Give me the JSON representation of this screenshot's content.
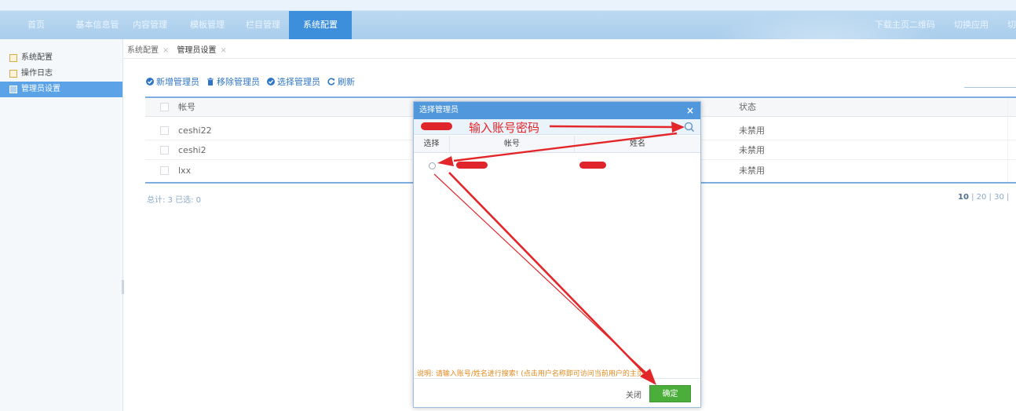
{
  "nav": {
    "items": [
      {
        "label": "首页"
      },
      {
        "label": "基本信息管理"
      },
      {
        "label": "内容管理"
      },
      {
        "label": "模板管理"
      },
      {
        "label": "栏目管理"
      },
      {
        "label": "系统配置",
        "active": true
      }
    ],
    "right": {
      "download": "下载主页二维码",
      "switch_app": "切换应用",
      "switch_more": "切"
    }
  },
  "sidebar": {
    "items": [
      {
        "label": "系统配置"
      },
      {
        "label": "操作日志"
      },
      {
        "label": "管理员设置",
        "active": true
      }
    ]
  },
  "tabs": [
    {
      "label": "系统配置",
      "close": "×"
    },
    {
      "label": "管理员设置",
      "close": "×",
      "active": true
    }
  ],
  "toolbar": {
    "add": "新增管理员",
    "remove": "移除管理员",
    "select": "选择管理员",
    "refresh": "刷新"
  },
  "table": {
    "columns": {
      "account": "帐号",
      "status": "状态"
    },
    "rows": [
      {
        "account": "ceshi22",
        "status": "未禁用"
      },
      {
        "account": "ceshi2",
        "status": "未禁用"
      },
      {
        "account": "lxx",
        "status": "未禁用"
      }
    ]
  },
  "footer": {
    "total": "总计: 3 已选: 0",
    "pager_current": "10",
    "pager_rest": " | 20 | 30 | "
  },
  "modal": {
    "title": "选择管理员",
    "close_symbol": "×",
    "columns": {
      "select": "选择",
      "account": "帐号",
      "name": "姓名"
    },
    "note": "说明: 请输入账号/姓名进行搜索! (点击用户名称即可访问当前用户的主页)",
    "close_button": "关闭",
    "confirm_button": "确定"
  },
  "annotation": {
    "text": "输入账号密码"
  },
  "colors": {
    "accent": "#5097db",
    "nav_active": "#3d8fdc",
    "sidebar_active": "#5ba3e6",
    "confirm": "#4cae3a",
    "annotation": "#e3262a",
    "note": "#e08a1e"
  }
}
